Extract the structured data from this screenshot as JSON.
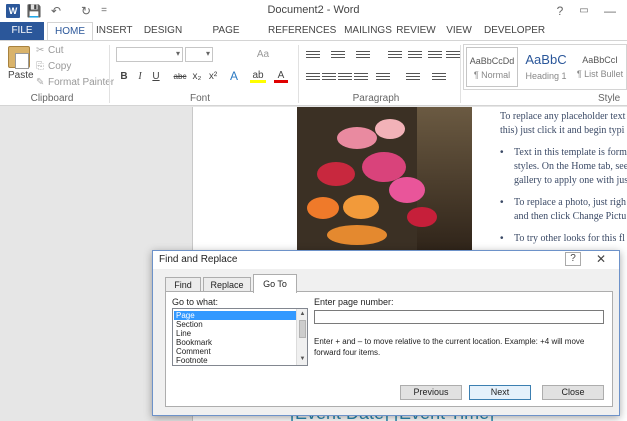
{
  "window": {
    "title": "Document2 - Word",
    "app_icon": "W",
    "qat": {
      "save_icon": "💾",
      "undo_icon": "↶",
      "redo_icon": "↻",
      "customize_icon": "="
    },
    "controls": {
      "help": "?",
      "ribbon_options": "▭",
      "minimize": "—"
    }
  },
  "tabs": [
    "FILE",
    "HOME",
    "INSERT",
    "DESIGN",
    "PAGE LAYOUT",
    "REFERENCES",
    "MAILINGS",
    "REVIEW",
    "VIEW",
    "DEVELOPER"
  ],
  "active_tab": "HOME",
  "ribbon": {
    "clipboard": {
      "paste": "Paste",
      "cut": "Cut",
      "copy": "Copy",
      "format_painter": "Format Painter",
      "label": "Clipboard"
    },
    "font": {
      "label": "Font",
      "font_name": "",
      "font_size": "",
      "bold": "B",
      "italic": "I",
      "underline": "U",
      "strike": "abc",
      "subscript": "x₂",
      "superscript": "x²",
      "grow_font": "Aa",
      "text_effects": "A",
      "highlight": "ab",
      "font_color": "A"
    },
    "paragraph": {
      "label": "Paragraph"
    },
    "styles": {
      "label": "Style",
      "items": [
        {
          "sample": "AaBbCcDd",
          "name": "¶ Normal"
        },
        {
          "sample": "AaBbC",
          "name": "Heading 1"
        },
        {
          "sample": "AaBbCcI",
          "name": "¶ List Bullet"
        }
      ]
    }
  },
  "document": {
    "lines": [
      "To replace any placeholder text",
      "this) just click it and begin typi",
      "Text in this template is form",
      "styles. On the Home tab, see",
      "gallery to apply one with jus",
      "To replace a photo, just righ",
      "and then click Change Pictu",
      "To try other looks for this fl"
    ],
    "banner": "[Event Date] [Event Time]"
  },
  "dialog": {
    "title": "Find and Replace",
    "help": "?",
    "close": "✕",
    "tabs": [
      "Find",
      "Replace",
      "Go To"
    ],
    "active_tab": "Go To",
    "go_to_what_label": "Go to what:",
    "go_to_items": [
      "Page",
      "Section",
      "Line",
      "Bookmark",
      "Comment",
      "Footnote"
    ],
    "selected_item": "Page",
    "enter_label": "Enter page number:",
    "page_value": "",
    "hint": "Enter + and – to move relative to the current location. Example: +4 will move forward four items.",
    "buttons": {
      "previous": "Previous",
      "next": "Next",
      "close": "Close"
    }
  }
}
